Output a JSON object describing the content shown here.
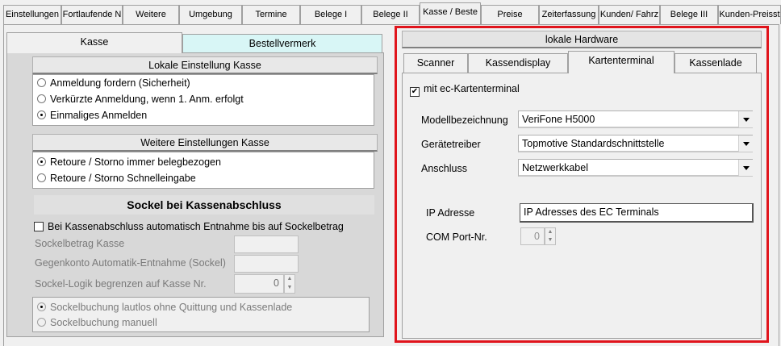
{
  "top_tabs": [
    "Einstellungen",
    "Fortlaufende N",
    "Weitere",
    "Umgebung",
    "Termine",
    "Belege I",
    "Belege II",
    "Kasse / Beste",
    "Preise",
    "Zeiterfassung",
    "Kunden/ Fahrz",
    "Belege III",
    "Kunden-Preisst"
  ],
  "left_tabs": {
    "kasse": "Kasse",
    "bestellvermerk": "Bestellvermerk"
  },
  "lokale": {
    "title": "Lokale Einstellung Kasse",
    "options": [
      "Anmeldung fordern (Sicherheit)",
      "Verkürzte Anmeldung, wenn 1. Anm. erfolgt",
      "Einmaliges Anmelden"
    ]
  },
  "weitere": {
    "title": "Weitere Einstellungen Kasse",
    "options": [
      "Retoure / Storno immer belegbezogen",
      "Retoure / Storno Schnelleingabe"
    ]
  },
  "sockel": {
    "title": "Sockel bei Kassenabschluss",
    "checkbox": "Bei Kassenabschluss automatisch Entnahme bis auf Sockelbetrag",
    "betrag_label": "Sockelbetrag Kasse",
    "gegenkonto_label": "Gegenkonto Automatik-Entnahme (Sockel)",
    "logik_label": "Sockel-Logik begrenzen auf Kasse Nr.",
    "logik_value": "0",
    "options": [
      "Sockelbuchung lautlos ohne Quittung und Kassenlade",
      "Sockelbuchung manuell"
    ]
  },
  "hardware": {
    "title": "lokale Hardware",
    "tabs": [
      "Scanner",
      "Kassendisplay",
      "Kartenterminal",
      "Kassenlade"
    ],
    "ec_checkbox": "mit ec-Kartenterminal",
    "modell_label": "Modellbezeichnung",
    "modell_value": "VeriFone H5000",
    "treiber_label": "Gerätetreiber",
    "treiber_value": "Topmotive Standardschnittstelle",
    "anschluss_label": "Anschluss",
    "anschluss_value": "Netzwerkkabel",
    "ip_label": "IP Adresse",
    "ip_value": "IP Adresses des EC Terminals",
    "com_label": "COM Port-Nr.",
    "com_value": "0",
    "highlight_color": "#e0141c"
  },
  "check_mark": "✔"
}
